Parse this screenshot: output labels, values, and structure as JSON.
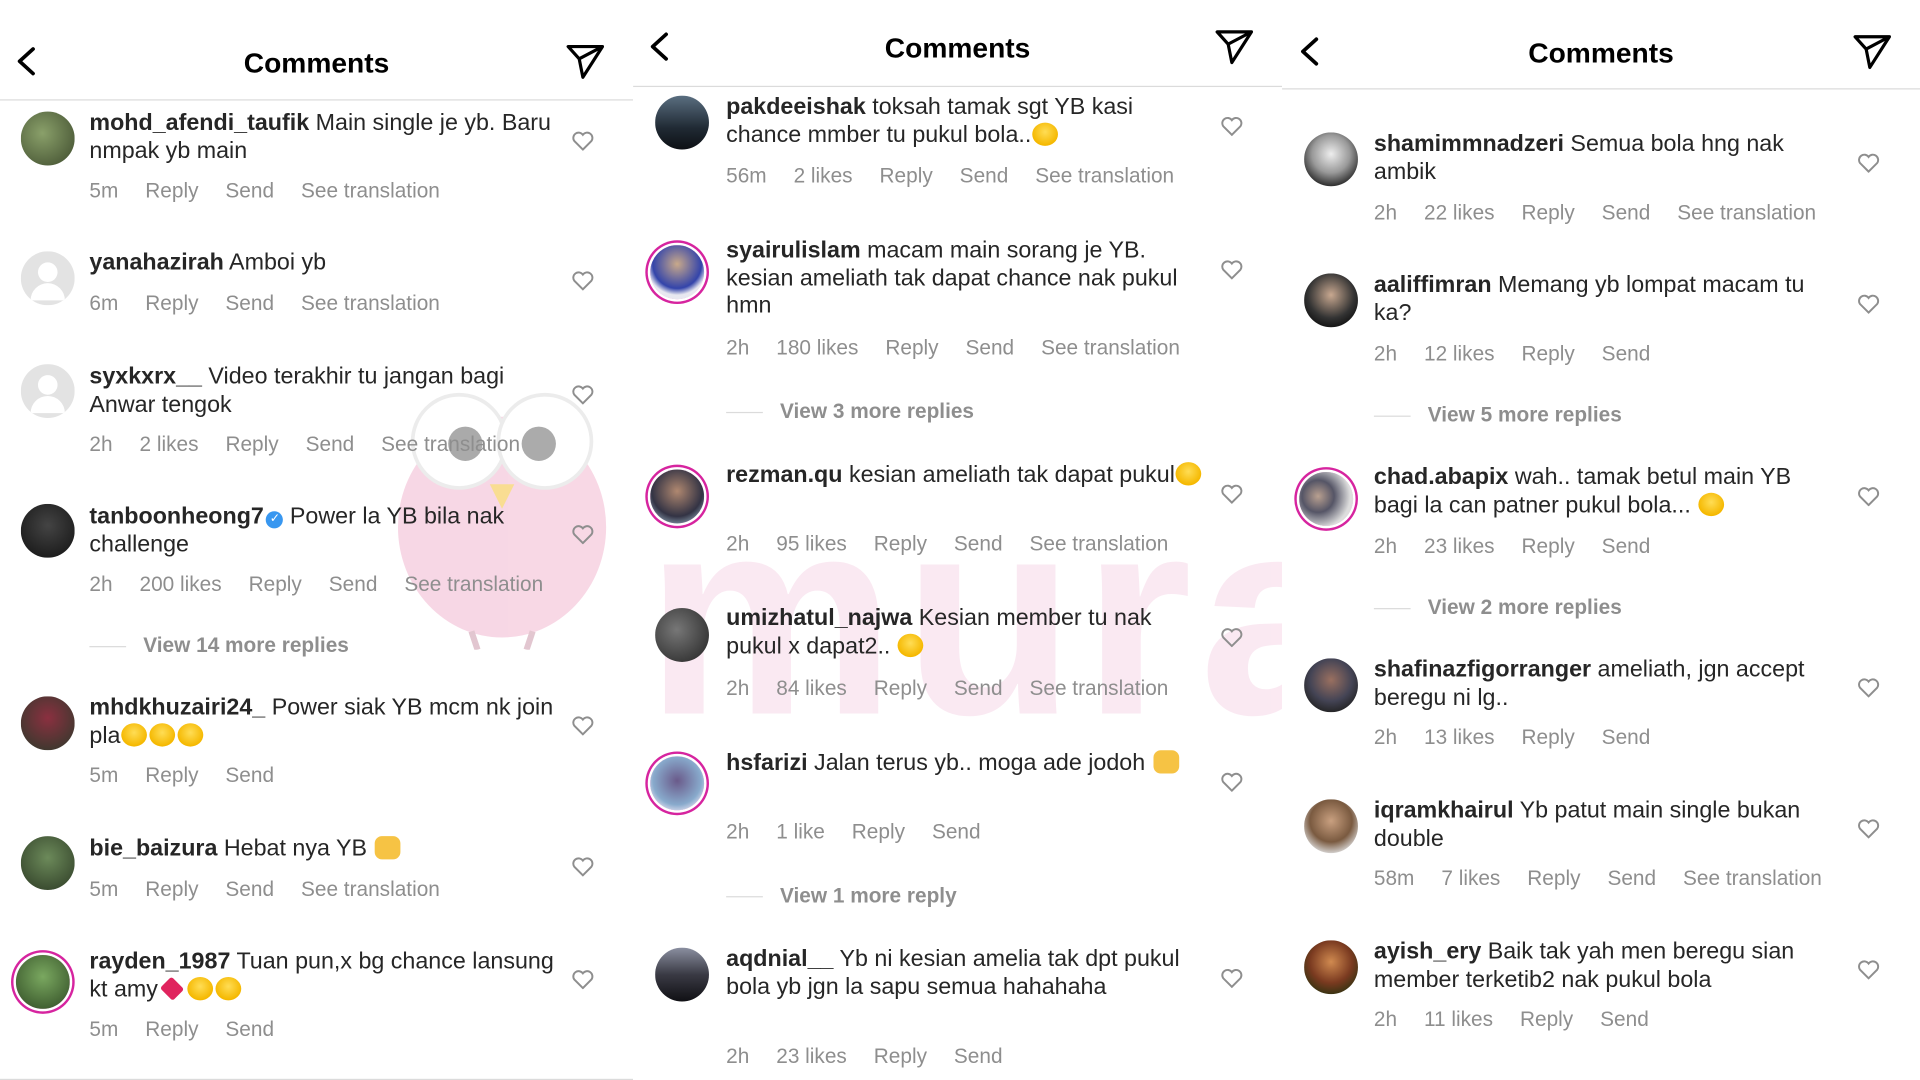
{
  "header": {
    "title": "Comments"
  },
  "watermark": "murai",
  "panels": [
    {
      "comments": [
        {
          "user": "mohd_afendi_taufik",
          "text": " Main single je yb. Baru nmpak yb main",
          "meta": [
            "5m",
            "Reply",
            "Send",
            "See translation"
          ]
        },
        {
          "user": "yanahazirah",
          "text": " Amboi yb",
          "meta": [
            "6m",
            "Reply",
            "Send",
            "See translation"
          ]
        },
        {
          "user": "syxkxrx__",
          "text": " Video terakhir tu jangan bagi Anwar tengok",
          "meta": [
            "2h",
            "2 likes",
            "Reply",
            "Send",
            "See translation"
          ]
        },
        {
          "user": "tanboonheong7",
          "text": " Power la YB bila nak challenge",
          "meta": [
            "2h",
            "200 likes",
            "Reply",
            "Send",
            "See translation"
          ],
          "more": "View 14 more replies"
        },
        {
          "user": "mhdkhuzairi24_",
          "text": " Power siak YB mcm nk join pla",
          "meta": [
            "5m",
            "Reply",
            "Send"
          ]
        },
        {
          "user": "bie_baizura",
          "text": " Hebat nya YB ",
          "meta": [
            "5m",
            "Reply",
            "Send",
            "See translation"
          ]
        },
        {
          "user": "rayden_1987",
          "text": " Tuan pun,x bg chance lansung kt amy",
          "meta": [
            "5m",
            "Reply",
            "Send"
          ]
        }
      ]
    },
    {
      "comments": [
        {
          "user": "pakdeeishak",
          "text": " toksah tamak sgt YB kasi chance mmber tu pukul bola..",
          "meta": [
            "56m",
            "2 likes",
            "Reply",
            "Send",
            "See translation"
          ]
        },
        {
          "user": "syairulislam",
          "text": " macam main sorang je YB. kesian ameliath tak dapat chance nak pukul hmn",
          "meta": [
            "2h",
            "180 likes",
            "Reply",
            "Send",
            "See translation"
          ],
          "more": "View 3 more replies"
        },
        {
          "user": "rezman.qu",
          "text": " kesian ameliath tak dapat pukul",
          "meta": [
            "2h",
            "95 likes",
            "Reply",
            "Send",
            "See translation"
          ]
        },
        {
          "user": "umizhatul_najwa",
          "text": " Kesian member tu nak pukul x dapat2.. ",
          "meta": [
            "2h",
            "84 likes",
            "Reply",
            "Send",
            "See translation"
          ]
        },
        {
          "user": "hsfarizi",
          "text": " Jalan terus yb.. moga ade jodoh ",
          "meta": [
            "2h",
            "1 like",
            "Reply",
            "Send"
          ],
          "more": "View 1 more reply"
        },
        {
          "user": "aqdnial__",
          "text": " Yb ni kesian amelia tak dpt pukul bola  yb jgn la sapu semua hahahaha",
          "meta": [
            "2h",
            "23 likes",
            "Reply",
            "Send"
          ]
        }
      ]
    },
    {
      "comments": [
        {
          "user": "shamimmnadzeri",
          "text": " Semua bola hng nak ambik",
          "meta": [
            "2h",
            "22 likes",
            "Reply",
            "Send",
            "See translation"
          ]
        },
        {
          "user": "aaliffimran",
          "text": " Memang yb lompat macam tu ka?",
          "meta": [
            "2h",
            "12 likes",
            "Reply",
            "Send"
          ],
          "more": "View 5 more replies"
        },
        {
          "user": "chad.abapix",
          "text": " wah.. tamak betul main YB bagi la can patner pukul bola... ",
          "meta": [
            "2h",
            "23 likes",
            "Reply",
            "Send"
          ],
          "more": "View 2 more replies"
        },
        {
          "user": "shafinazfigorranger",
          "text": " ameliath, jgn accept beregu ni lg..",
          "meta": [
            "2h",
            "13 likes",
            "Reply",
            "Send"
          ]
        },
        {
          "user": "iqramkhairul",
          "text": " Yb patut main single bukan double",
          "meta": [
            "58m",
            "7 likes",
            "Reply",
            "Send",
            "See translation"
          ]
        },
        {
          "user": "ayish_ery",
          "text": " Baik tak yah men beregu sian member terketib2 nak pukul bola",
          "meta": [
            "2h",
            "11 likes",
            "Reply",
            "Send"
          ]
        }
      ]
    }
  ],
  "colors": {
    "text": "#262626",
    "meta": "#8e8e8e",
    "divider": "#dbdbdb",
    "story_ring": "#d6249f",
    "verified": "#3897f0"
  },
  "icons": [
    "back-arrow-icon",
    "send-icon",
    "heart-icon",
    "verified-badge-icon",
    "emoji"
  ]
}
